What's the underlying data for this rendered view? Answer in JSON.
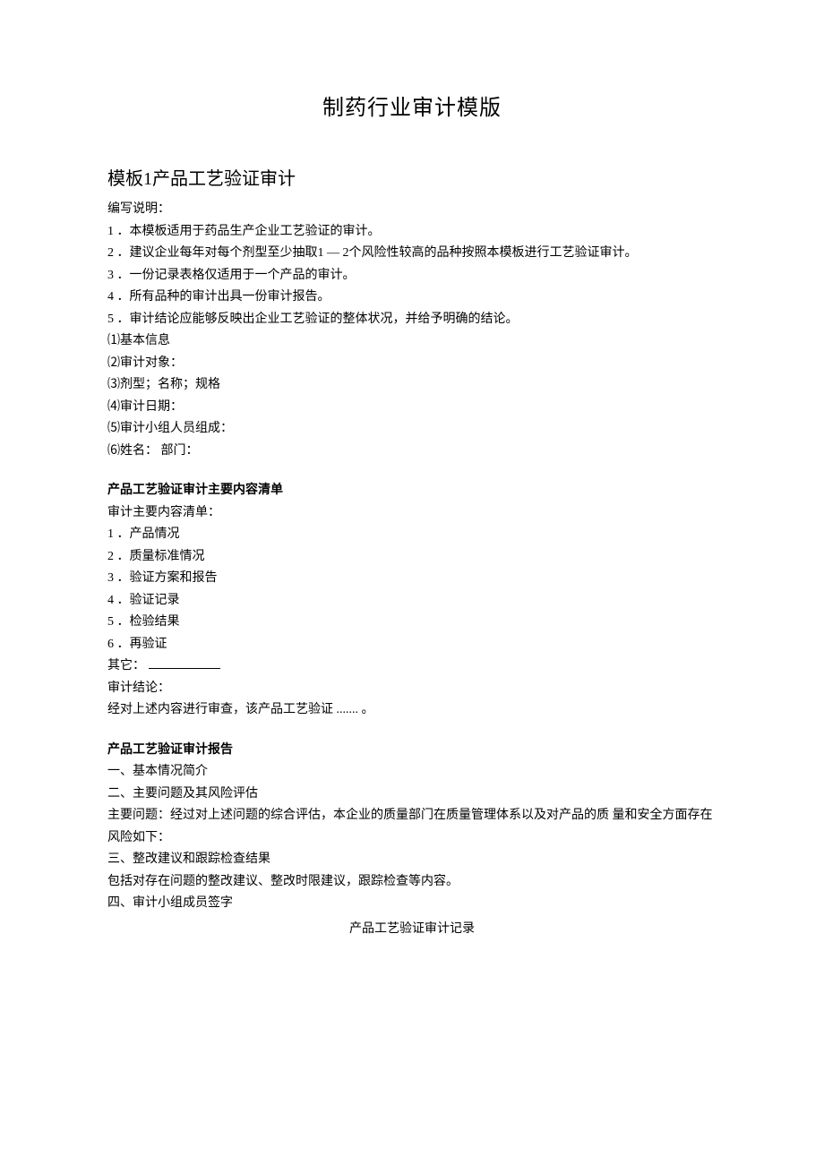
{
  "doc_title": "制药行业审计模版",
  "section_title": "模板1产品工艺验证审计",
  "intro_label": "编写说明：",
  "intro_items": [
    "1 ．本模板适用于药品生产企业工艺验证的审计。",
    "2 ．建议企业每年对每个剂型至少抽取1 — 2个风险性较高的品种按照本模板进行工艺验证审计。",
    "3 ．一份记录表格仅适用于一个产品的审计。",
    "4 ．所有品种的审计出具一份审计报告。",
    "5 ．审计结论应能够反映出企业工艺验证的整体状况，并给予明确的结论。"
  ],
  "basic_info": [
    "⑴基本信息",
    "⑵审计对象：",
    "⑶剂型；名称；规格",
    "⑷审计日期：",
    "⑸审计小组人员组成：",
    "⑹姓名：   部门："
  ],
  "checklist_heading": "产品工艺验证审计主要内容清单",
  "checklist_label": "审计主要内容清单：",
  "checklist_items": [
    "1 ．产品情况",
    "2 ．质量标准情况",
    "3 ．验证方案和报告",
    "4 ．验证记录",
    "5 ．检验结果",
    "6 ．再验证"
  ],
  "other_label": "其它：",
  "conclusion_label": "审计结论：",
  "conclusion_text": "经对上述内容进行审查，该产品工艺验证 ....... 。",
  "report_heading": "产品工艺验证审计报告",
  "report_lines": [
    "一、基本情况简介",
    "二、主要问题及其风险评估",
    "主要问题：经过对上述问题的综合评估，本企业的质量部门在质量管理体系以及对产品的质  量和安全方面存在风险如下：",
    "三、整改建议和跟踪检查结果",
    "包括对存在问题的整改建议、整改时限建议，跟踪检查等内容。",
    "四、审计小组成员签字"
  ],
  "record_title": "产品工艺验证审计记录"
}
